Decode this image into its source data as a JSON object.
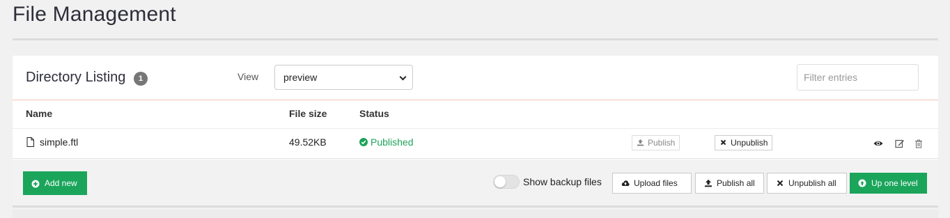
{
  "page": {
    "title": "File Management"
  },
  "listing": {
    "title": "Directory Listing",
    "count": "1",
    "view_label": "View",
    "view_selected": "preview",
    "filter_placeholder": "Filter entries"
  },
  "columns": {
    "name": "Name",
    "size": "File size",
    "status": "Status"
  },
  "rows": [
    {
      "name": "simple.ftl",
      "size": "49.52KB",
      "status": "Published",
      "publish_label": "Publish",
      "unpublish_label": "Unpublish"
    }
  ],
  "footer": {
    "add_new": "Add new",
    "show_backup": "Show backup files",
    "upload": "Upload files",
    "publish_all": "Publish all",
    "unpublish_all": "Unpublish all",
    "up_level": "Up one level"
  },
  "colors": {
    "accent_green": "#1aa55b",
    "status_green": "#1ea35a",
    "header_rule": "#f3c4b3"
  },
  "icons": [
    "file-icon",
    "check-circle-icon",
    "upload-icon",
    "close-icon",
    "eye-icon",
    "edit-icon",
    "trash-icon",
    "plus-circle-icon",
    "cloud-upload-icon",
    "arrow-up-circle-icon",
    "chevron-down-icon"
  ]
}
